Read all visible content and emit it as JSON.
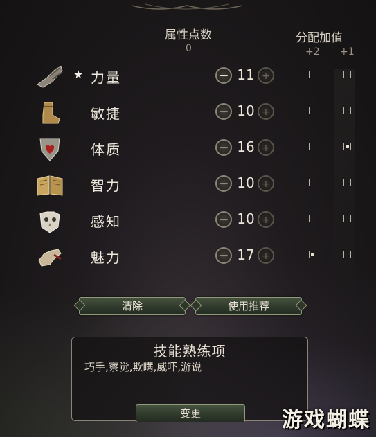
{
  "header": {
    "points_label": "属性点数",
    "points_value": "0",
    "bonus_label": "分配加值",
    "plus2": "+2",
    "plus1": "+1"
  },
  "stats": [
    {
      "name": "力量",
      "value": "11",
      "star": "★",
      "icon": "gauntlet-icon",
      "bonus2": false,
      "bonus1": false
    },
    {
      "name": "敏捷",
      "value": "10",
      "star": "",
      "icon": "boot-icon",
      "bonus2": false,
      "bonus1": false
    },
    {
      "name": "体质",
      "value": "16",
      "star": "",
      "icon": "heart-shield-icon",
      "bonus2": false,
      "bonus1": true
    },
    {
      "name": "智力",
      "value": "10",
      "star": "",
      "icon": "open-book-icon",
      "bonus2": false,
      "bonus1": false
    },
    {
      "name": "感知",
      "value": "10",
      "star": "",
      "icon": "owl-mask-icon",
      "bonus2": false,
      "bonus1": false
    },
    {
      "name": "魅力",
      "value": "17",
      "star": "",
      "icon": "hand-icon",
      "bonus2": true,
      "bonus1": false
    }
  ],
  "buttons": {
    "minus": "−",
    "plus": "+",
    "clear": "清除",
    "recommend": "使用推荐",
    "change": "变更"
  },
  "proficiency": {
    "title": "技能熟练项",
    "skills": "巧手,察觉,欺瞒,威吓,游说"
  },
  "watermark": "游戏蝴蝶",
  "colors": {
    "button_green": "#2e382b",
    "text_light": "#ece6da",
    "background": "#1f1b1e"
  }
}
